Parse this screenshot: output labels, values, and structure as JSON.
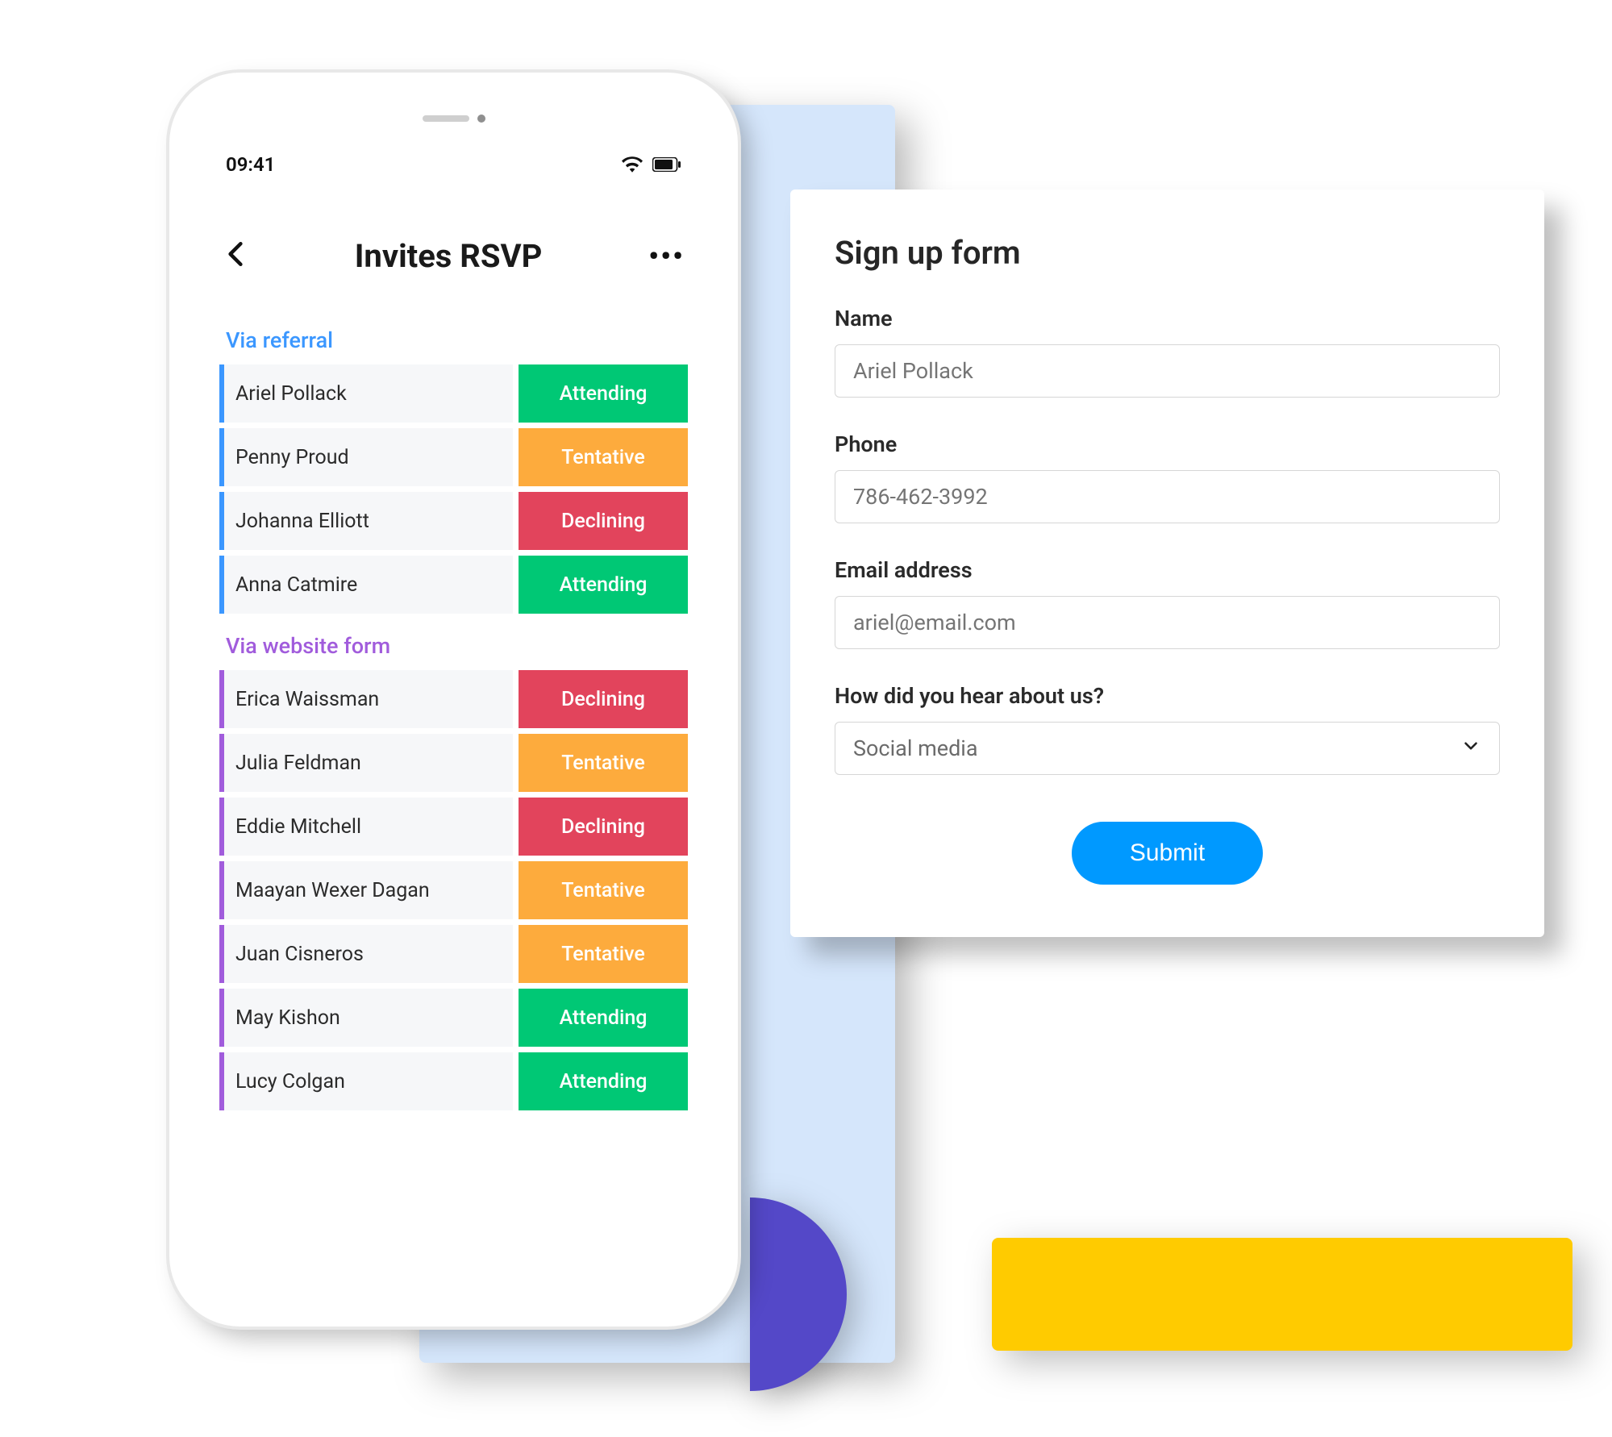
{
  "phone": {
    "status_time": "09:41",
    "header_title": "Invites RSVP",
    "groups": [
      {
        "label": "Via referral",
        "color_class": "grp-blue",
        "stripe_class": "stripe-blue",
        "items": [
          {
            "name": "Ariel Pollack",
            "status": "Attending",
            "status_class": "s-attending"
          },
          {
            "name": "Penny Proud",
            "status": "Tentative",
            "status_class": "s-tentative"
          },
          {
            "name": "Johanna Elliott",
            "status": "Declining",
            "status_class": "s-declining"
          },
          {
            "name": "Anna Catmire",
            "status": "Attending",
            "status_class": "s-attending"
          }
        ]
      },
      {
        "label": "Via website form",
        "color_class": "grp-purple",
        "stripe_class": "stripe-purple",
        "items": [
          {
            "name": "Erica Waissman",
            "status": "Declining",
            "status_class": "s-declining"
          },
          {
            "name": "Julia Feldman",
            "status": "Tentative",
            "status_class": "s-tentative"
          },
          {
            "name": "Eddie Mitchell",
            "status": "Declining",
            "status_class": "s-declining"
          },
          {
            "name": "Maayan Wexer Dagan",
            "status": "Tentative",
            "status_class": "s-tentative"
          },
          {
            "name": "Juan Cisneros",
            "status": "Tentative",
            "status_class": "s-tentative"
          },
          {
            "name": "May Kishon",
            "status": "Attending",
            "status_class": "s-attending"
          },
          {
            "name": "Lucy Colgan",
            "status": "Attending",
            "status_class": "s-attending"
          }
        ]
      }
    ]
  },
  "form": {
    "title": "Sign up form",
    "fields": {
      "name_label": "Name",
      "name_placeholder": "Ariel Pollack",
      "phone_label": "Phone",
      "phone_placeholder": "786-462-3992",
      "email_label": "Email address",
      "email_placeholder": "ariel@email.com",
      "source_label": "How did you hear about us?",
      "source_value": "Social media"
    },
    "submit_label": "Submit"
  }
}
